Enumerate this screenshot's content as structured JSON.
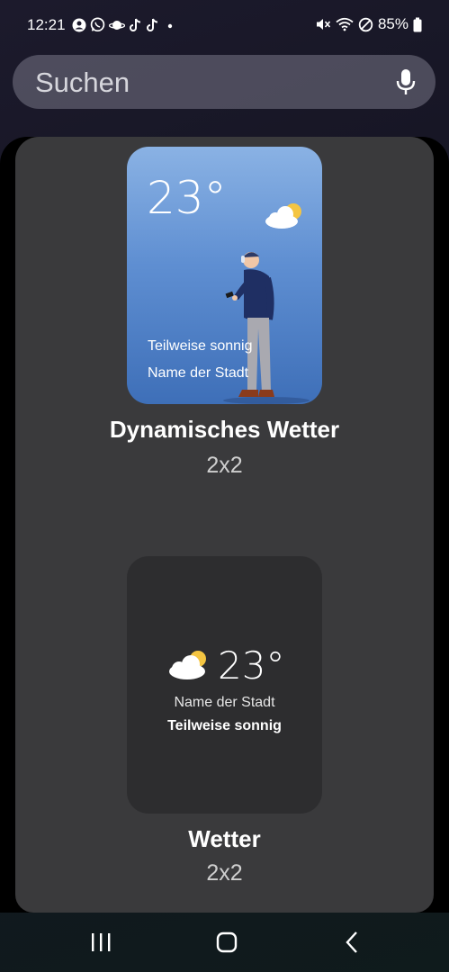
{
  "status_bar": {
    "time": "12:21",
    "battery": "85%",
    "app_icons": [
      "account-icon",
      "whatsapp-icon",
      "saturn-icon",
      "tiktok-icon",
      "tiktok-icon",
      "dot-icon"
    ],
    "system_icons": [
      "mute-icon",
      "wifi-icon",
      "do-not-disturb-icon",
      "battery-icon"
    ]
  },
  "search": {
    "placeholder": "Suchen"
  },
  "widgets": [
    {
      "preview": {
        "temperature": "23°",
        "condition": "Teilweise sonnig",
        "city": "Name der Stadt"
      },
      "title": "Dynamisches Wetter",
      "size": "2x2"
    },
    {
      "preview": {
        "temperature": "23°",
        "city": "Name der Stadt",
        "condition": "Teilweise sonnig"
      },
      "title": "Wetter",
      "size": "2x2"
    }
  ],
  "colors": {
    "panel_bg": "#3a3a3c",
    "card1_top": "#8ab2e4",
    "card1_bottom": "#3e6fb8",
    "card2_bg": "#2d2d2f",
    "sun": "#f4c542"
  }
}
